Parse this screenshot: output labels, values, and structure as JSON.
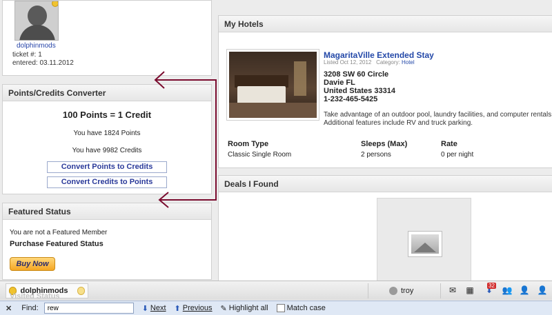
{
  "profile": {
    "username": "dolphinmods",
    "ticket": "ticket #: 1",
    "entered": "entered: 03.11.2012"
  },
  "converter": {
    "title": "Points/Credits Converter",
    "rate": "100 Points = 1 Credit",
    "points_line": "You have 1824 Points",
    "credits_line": "You have 9982 Credits",
    "btn_points_to_credits": "Convert Points to Credits",
    "btn_credits_to_points": "Convert Credits to Points"
  },
  "featured": {
    "title": "Featured Status",
    "status": "You are not a Featured Member",
    "purchase": "Purchase Featured Status",
    "buy": "Buy Now"
  },
  "hotels": {
    "title": "My Hotels",
    "name": "MagaritaVille Extended Stay",
    "listed": "Listed Oct 12, 2012",
    "category_label": "Category:",
    "category": "Hotel",
    "addr1": "3208 SW 60 Circle",
    "addr2": "Davie FL",
    "addr3": "United States 33314",
    "phone": "1-232-465-5425",
    "desc_line1": "Take advantage of an outdoor pool, laundry facilities, and computer rentals",
    "desc_line2": "Additional features include RV and truck parking.",
    "headers": {
      "room": "Room Type",
      "sleeps": "Sleeps (Max)",
      "rate": "Rate"
    },
    "row": {
      "room": "Classic Single Room",
      "sleeps": "2 persons",
      "rate": "0 per night"
    }
  },
  "deals": {
    "title": "Deals I Found"
  },
  "chatbar": {
    "user": "dolphinmods",
    "hidden_status": "Visited Status",
    "contact": "troy",
    "notif_count": "32"
  },
  "findbar": {
    "find_label": "Find:",
    "find_value": "rew",
    "next": "Next",
    "previous": "Previous",
    "highlight": "Highlight all",
    "matchcase": "Match case"
  },
  "colors": {
    "link": "#2348a8",
    "arrow": "#7a0b2e",
    "buy": "#f5a623"
  }
}
